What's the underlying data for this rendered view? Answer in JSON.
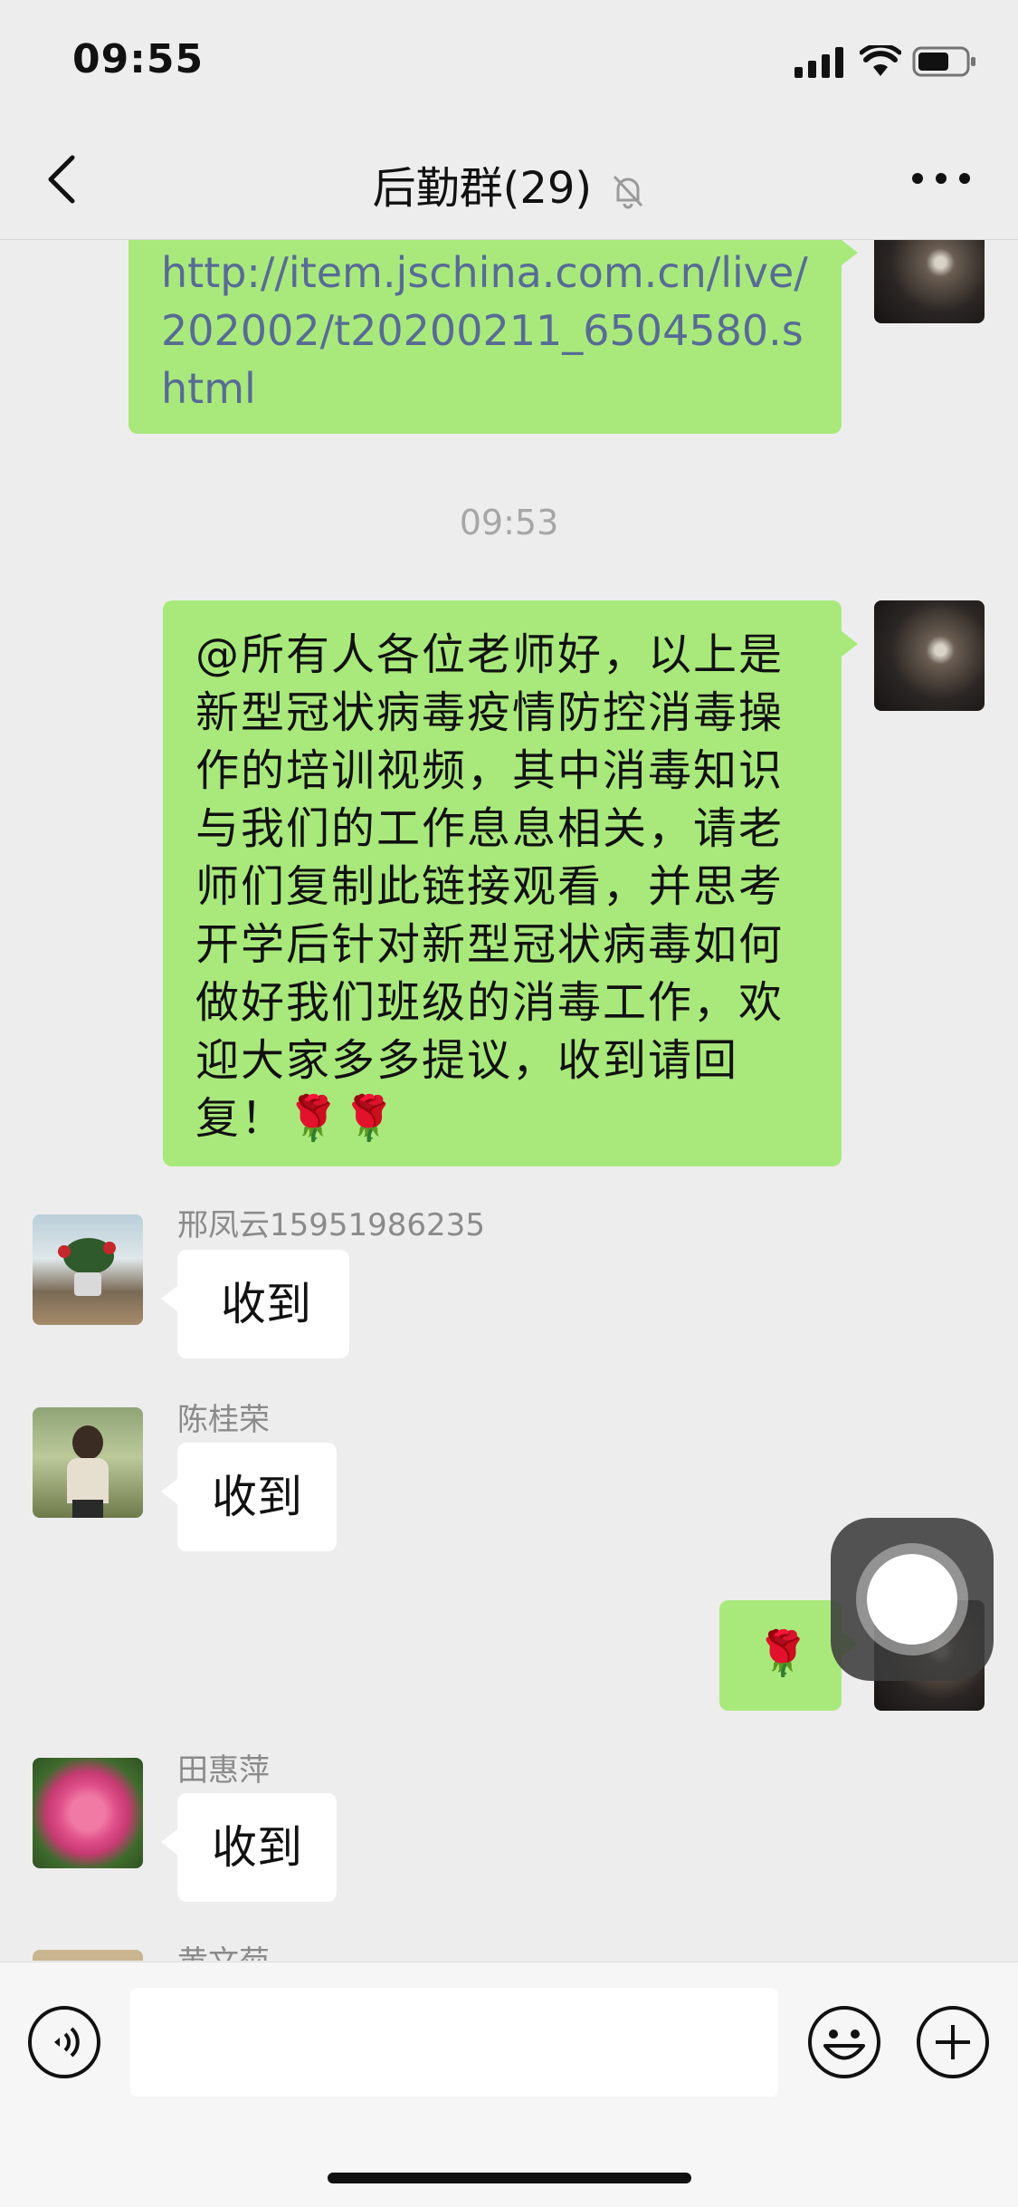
{
  "status_bar": {
    "time": "09:55"
  },
  "header": {
    "title": "后勤群(29)"
  },
  "messages": {
    "link": {
      "text": "http://item.jschina.com.cn/live/202002/t20200211_6504580.shtml"
    },
    "timestamp": "09:53",
    "notice": {
      "text": "@所有人各位老师好，以上是新型冠状病毒疫情防控消毒操作的培训视频，其中消毒知识与我们的工作息息相关，请老师们复制此链接观看，并思考开学后针对新型冠状病毒如何做好我们班级的消毒工作，欢迎大家多多提议，收到请回复！🌹🌹"
    },
    "reply1": {
      "sender": "邢凤云15951986235",
      "text": "收到"
    },
    "reply2": {
      "sender": "陈桂荣",
      "text": "收到"
    },
    "mine_rose": {
      "text": "🌹"
    },
    "reply3": {
      "sender": "田惠萍",
      "text": "收到"
    },
    "reply4": {
      "sender": "黄文菊"
    }
  },
  "colors": {
    "background": "#ededed",
    "my_bubble": "#a9e97c",
    "other_bubble": "#ffffff",
    "link": "#576b95"
  },
  "icons": {
    "back": "chevron-left-icon",
    "mute": "bell-slash-icon",
    "more": "ellipsis-icon",
    "voice": "voice-icon",
    "emoji": "emoji-icon",
    "plus": "plus-circle-icon"
  }
}
